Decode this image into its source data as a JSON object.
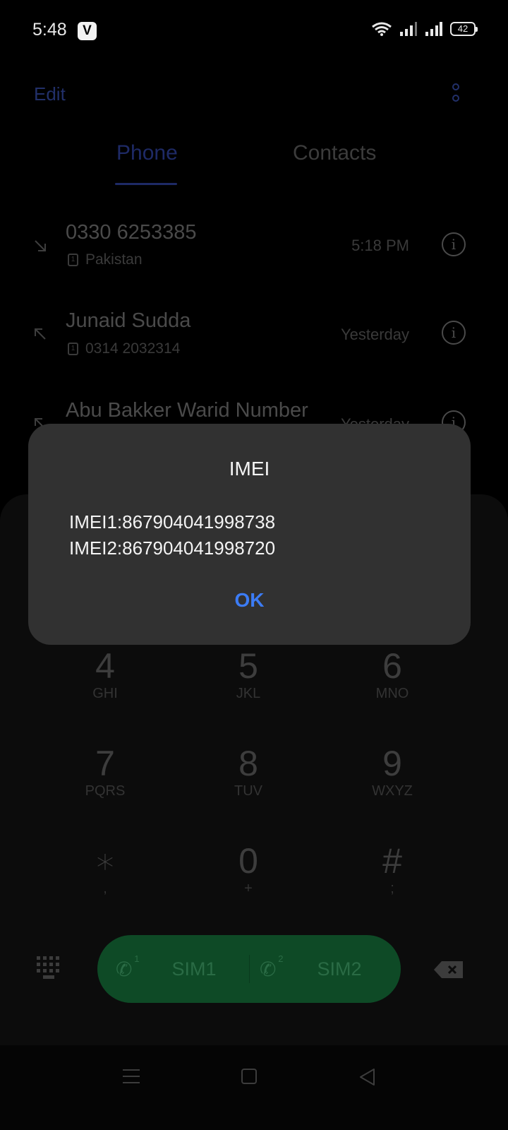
{
  "status_bar": {
    "time": "5:48",
    "app_icon_letter": "V",
    "battery": "42"
  },
  "header": {
    "edit_label": "Edit",
    "tabs": [
      {
        "label": "Phone",
        "active": true
      },
      {
        "label": "Contacts",
        "active": false
      }
    ]
  },
  "call_log": [
    {
      "name": "0330 6253385",
      "sub": "Pakistan",
      "time": "5:18 PM",
      "direction": "incoming"
    },
    {
      "name": "Junaid Sudda",
      "sub": "0314 2032314",
      "time": "Yesterday",
      "direction": "outgoing"
    },
    {
      "name": "Abu Bakker Warid Number",
      "sub": "",
      "time": "Yesterday",
      "direction": "outgoing"
    }
  ],
  "keypad": {
    "keys": [
      {
        "digit": "4",
        "letters": "GHI"
      },
      {
        "digit": "5",
        "letters": "JKL"
      },
      {
        "digit": "6",
        "letters": "MNO"
      },
      {
        "digit": "7",
        "letters": "PQRS"
      },
      {
        "digit": "8",
        "letters": "TUV"
      },
      {
        "digit": "9",
        "letters": "WXYZ"
      },
      {
        "digit": "∗",
        "letters": ","
      },
      {
        "digit": "0",
        "letters": "+"
      },
      {
        "digit": "#",
        "letters": ";"
      }
    ],
    "sim1_label": "SIM1",
    "sim2_label": "SIM2",
    "sim1_badge": "1",
    "sim2_badge": "2",
    "call_color": "#0e4a26"
  },
  "dialog": {
    "title": "IMEI",
    "lines": [
      "IMEI1:867904041998738",
      "IMEI2:867904041998720"
    ],
    "ok_label": "OK",
    "ok_color": "#3c7cf5"
  },
  "icons": {
    "status": [
      "wifi-icon",
      "signal-icon",
      "signal-icon",
      "battery-icon"
    ],
    "header": [
      "more-vertical-icon"
    ],
    "nav": [
      "menu-icon",
      "home-icon",
      "back-icon"
    ]
  }
}
